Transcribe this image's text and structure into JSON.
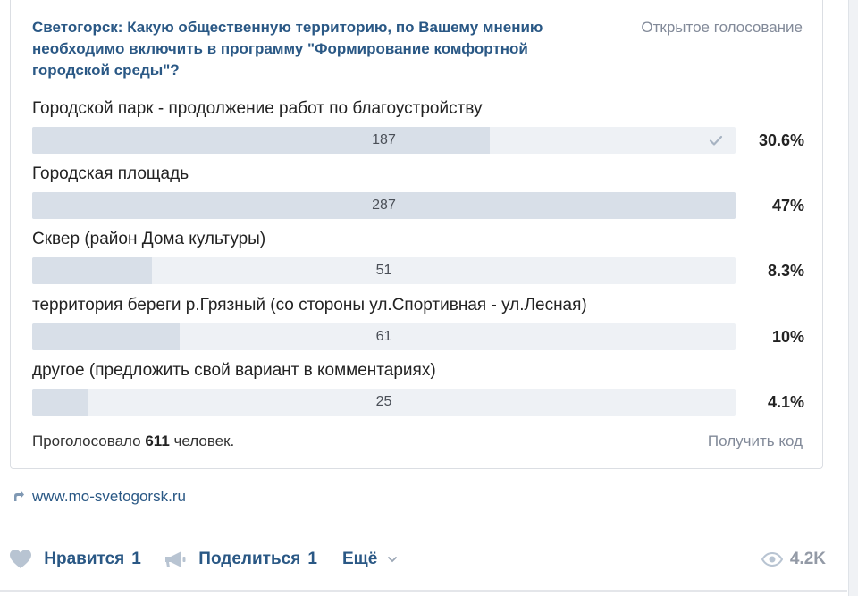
{
  "poll": {
    "title": "Светогорск: Какую общественную территорию, по Вашему мнению необходимо включить в программу \"Формирование комфортной городской среды\"?",
    "type": "Открытое голосование",
    "options": [
      {
        "label": "Городской парк - продолжение работ по благоустройству",
        "count": "187",
        "percent": "30.6%",
        "fill": 0.65,
        "checked": true
      },
      {
        "label": "Городская площадь",
        "count": "287",
        "percent": "47%",
        "fill": 1.0,
        "checked": false
      },
      {
        "label": "Сквер (район Дома культуры)",
        "count": "51",
        "percent": "8.3%",
        "fill": 0.17,
        "checked": false
      },
      {
        "label": "территория береги р.Грязный (со стороны ул.Спортивная - ул.Лесная)",
        "count": "61",
        "percent": "10%",
        "fill": 0.21,
        "checked": false
      },
      {
        "label": "другое (предложить свой вариант в комментариях)",
        "count": "25",
        "percent": "4.1%",
        "fill": 0.08,
        "checked": false
      }
    ],
    "footer_prefix": "Проголосовало",
    "total_votes": "611",
    "footer_suffix": "человек.",
    "get_code": "Получить код"
  },
  "link": {
    "url": "www.mo-svetogorsk.ru",
    "icon": "external-link-arrow-icon"
  },
  "actions": {
    "like_label": "Нравится",
    "like_count": "1",
    "share_label": "Поделиться",
    "share_count": "1",
    "more_label": "Ещё",
    "views": "4.2K"
  },
  "colors": {
    "link": "#2a5885",
    "muted": "#828a99",
    "bar_bg": "#eef1f5",
    "bar_fill": "#d8dfe8"
  }
}
